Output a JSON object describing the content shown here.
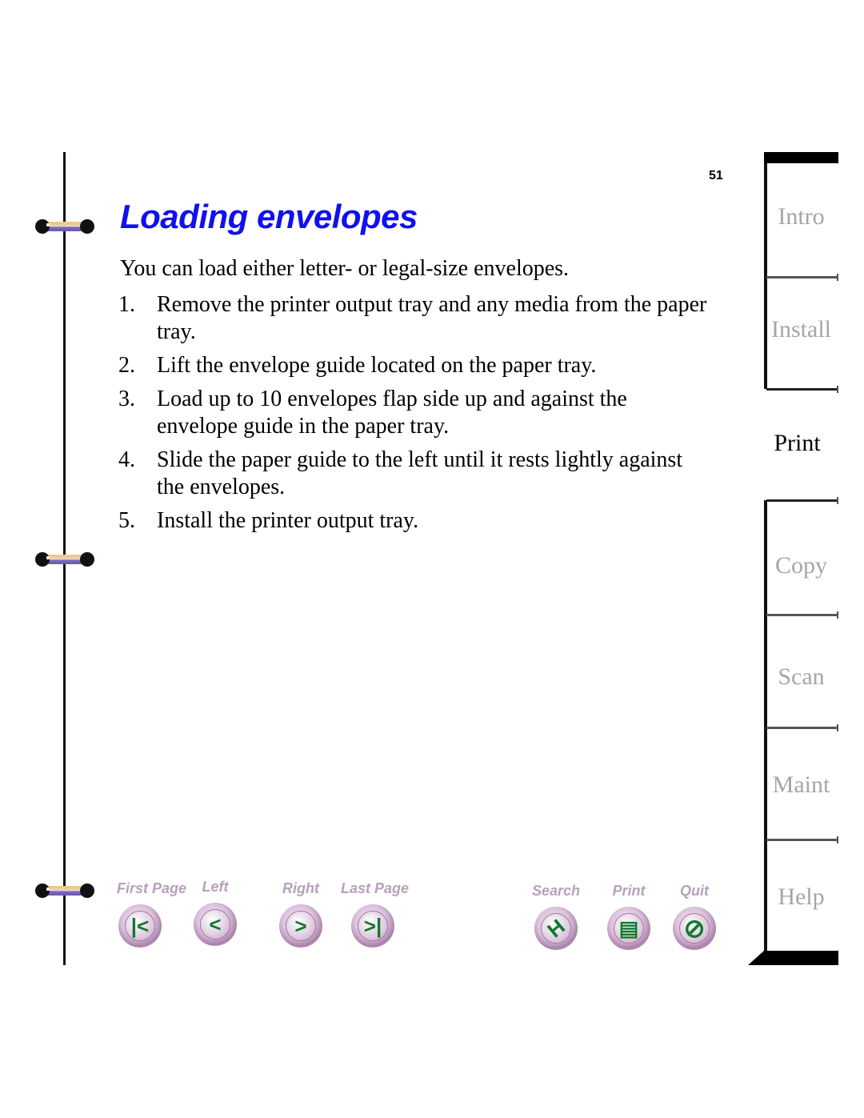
{
  "page": {
    "number": "51",
    "title": "Loading envelopes",
    "intro": "You can load either letter- or legal-size envelopes.",
    "steps": [
      {
        "num": "1.",
        "text": "Remove the printer output tray and any media from the paper tray."
      },
      {
        "num": "2.",
        "text": "Lift the envelope guide located on the paper tray."
      },
      {
        "num": "3.",
        "text": "Load up to 10 envelopes flap side up and against the envelope guide in the paper tray."
      },
      {
        "num": "4.",
        "text": "Slide the paper guide to the left until it rests lightly against the envelopes."
      },
      {
        "num": "5.",
        "text": "Install the printer output tray."
      }
    ]
  },
  "navigation": {
    "first_page": {
      "label": "First Page",
      "icon": "first-page-icon",
      "glyph": "|<"
    },
    "left": {
      "label": "Left",
      "icon": "arrow-left-icon",
      "glyph": "<"
    },
    "right": {
      "label": "Right",
      "icon": "arrow-right-icon",
      "glyph": ">"
    },
    "last_page": {
      "label": "Last Page",
      "icon": "last-page-icon",
      "glyph": ">|"
    },
    "search": {
      "label": "Search",
      "icon": "binoculars-icon",
      "glyph": "H"
    },
    "print": {
      "label": "Print",
      "icon": "document-icon",
      "glyph": "▤"
    },
    "quit": {
      "label": "Quit",
      "icon": "prohibited-icon",
      "glyph": "⊘"
    }
  },
  "tabs": [
    {
      "label": "Intro",
      "active": false
    },
    {
      "label": "Install",
      "active": false
    },
    {
      "label": "Print",
      "active": true
    },
    {
      "label": "Copy",
      "active": false
    },
    {
      "label": "Scan",
      "active": false
    },
    {
      "label": "Maint",
      "active": false
    },
    {
      "label": "Help",
      "active": false
    }
  ],
  "colors": {
    "title": "#1010f0",
    "nav_label": "#b8a0bc",
    "nav_glyph": "#0e7a2a",
    "tab_inactive": "#a6a6a6",
    "tab_active": "#000000"
  }
}
